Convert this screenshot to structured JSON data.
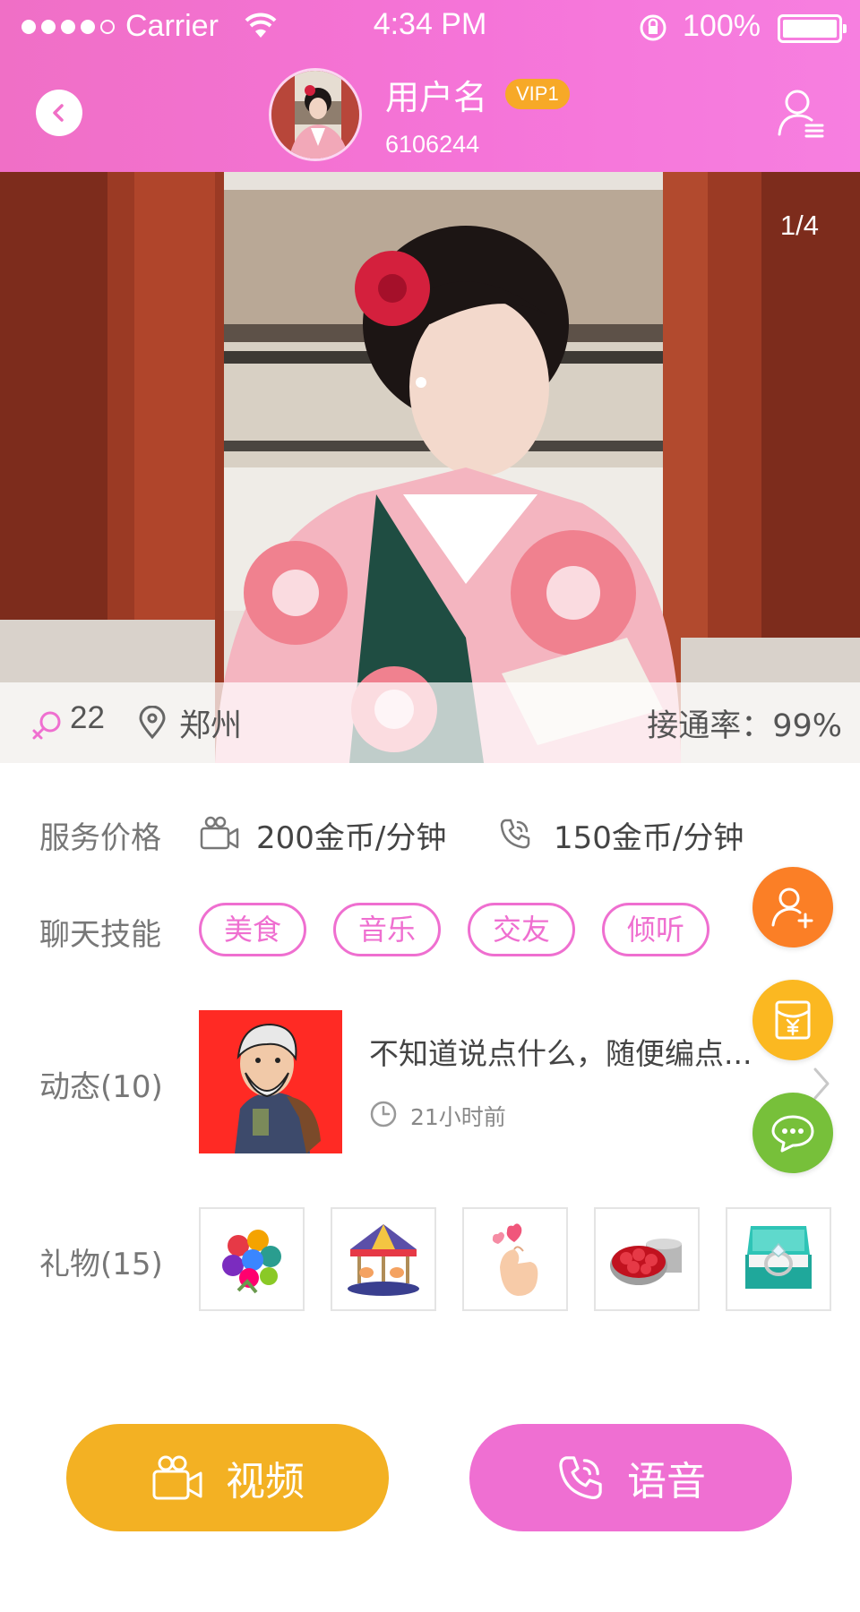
{
  "status_bar": {
    "carrier": "Carrier",
    "time": "4:34 PM",
    "battery": "100%",
    "signal_bars_filled": 4,
    "signal_bars_total": 5
  },
  "header": {
    "username": "用户名",
    "vip_badge": "VIP1",
    "user_id": "6106244"
  },
  "photo": {
    "counter": "1/4",
    "age": "22",
    "city": "郑州",
    "connect_rate": "接通率：99%"
  },
  "services": {
    "label": "服务价格",
    "video_price": "200金币/分钟",
    "voice_price": "150金币/分钟"
  },
  "skills": {
    "label": "聊天技能",
    "tags": [
      "美食",
      "音乐",
      "交友",
      "倾听"
    ]
  },
  "moments": {
    "label": "动态(10)",
    "text": "不知道说点什么，随便编点...",
    "time": "21小时前"
  },
  "gifts": {
    "label": "礼物(15)",
    "items": [
      "rainbow-roses-icon",
      "carousel-icon",
      "finger-heart-icon",
      "rose-box-icon",
      "ring-box-icon"
    ]
  },
  "actions": {
    "video": "视频",
    "voice": "语音"
  },
  "colors": {
    "header_pink": "#f574d8",
    "accent_pink": "#ef6fd0",
    "vip_orange": "#f7a927",
    "video_yellow": "#f3b123",
    "follow_orange": "#fb7f26",
    "gift_yellow": "#fbb821",
    "chat_green": "#77c03a"
  }
}
